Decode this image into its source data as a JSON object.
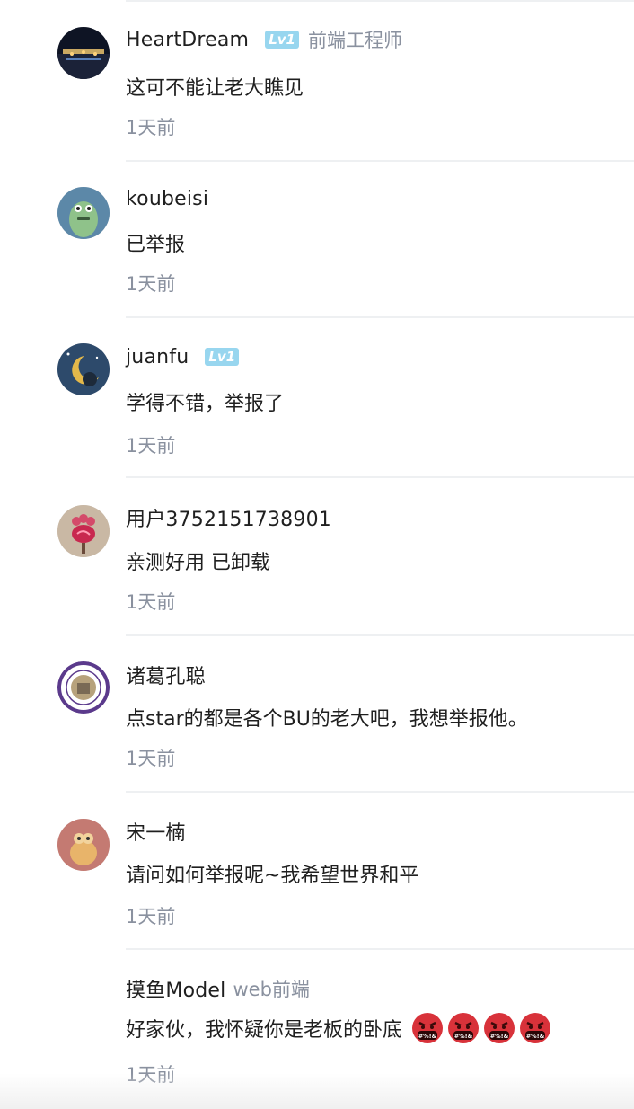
{
  "comments": [
    {
      "username": "HeartDream",
      "level": "Lv1",
      "job": "前端工程师",
      "content": "这可不能让老大瞧见",
      "time": "1天前"
    },
    {
      "username": "koubeisi",
      "level": "",
      "job": "",
      "content": "已举报",
      "time": "1天前"
    },
    {
      "username": "juanfu",
      "level": "Lv1",
      "job": "",
      "content": "学得不错，举报了",
      "time": "1天前"
    },
    {
      "username": "用户3752151738901",
      "level": "",
      "job": "",
      "content": "亲测好用 已卸载",
      "time": "1天前"
    },
    {
      "username": "诸葛孔聪",
      "level": "",
      "job": "",
      "content": "点star的都是各个BU的老大吧，我想举报他。",
      "time": "1天前"
    },
    {
      "username": "宋一楠",
      "level": "",
      "job": "",
      "content": "请问如何举报呢~我希望世界和平",
      "time": "1天前"
    },
    {
      "username": "摸鱼Model",
      "level": "",
      "job": "web前端",
      "content": "好家伙，我怀疑你是老板的卧底",
      "time": "1天前",
      "emoji_text": "#%!&",
      "emoji_count": 4
    }
  ],
  "colors": {
    "badge": "#98d6ef",
    "muted": "#8a919f",
    "text": "#1f1f1f",
    "divider": "#eef0f2",
    "angry_face": "#d8323a"
  }
}
